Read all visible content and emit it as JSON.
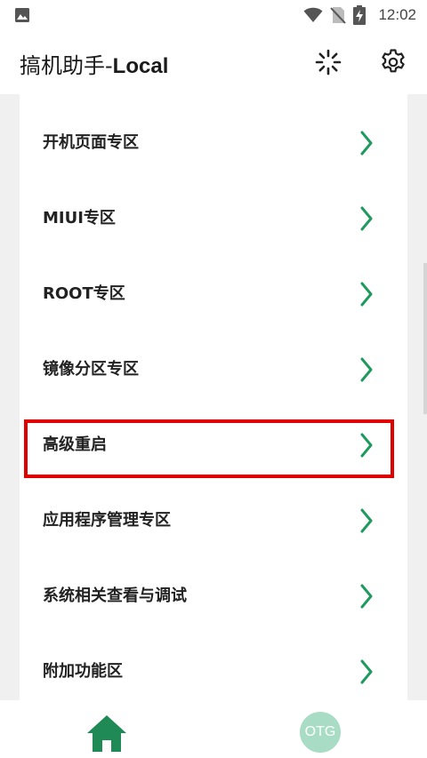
{
  "status_bar": {
    "time": "12:02",
    "icons": [
      "image-notification-icon",
      "wifi-icon",
      "no-sim-icon",
      "battery-charging-icon"
    ]
  },
  "app_bar": {
    "title_prefix": "搞机助手-",
    "title_suffix": "Local",
    "actions": [
      "loading-spinner-icon",
      "settings-gear-icon"
    ]
  },
  "menu": {
    "items": [
      {
        "label": "开机页面专区"
      },
      {
        "label": "MIUI专区"
      },
      {
        "label": "ROOT专区"
      },
      {
        "label": "镜像分区专区"
      },
      {
        "label": "高级重启",
        "highlighted": true
      },
      {
        "label": "应用程序管理专区"
      },
      {
        "label": "系统相关查看与调试"
      },
      {
        "label": "附加功能区"
      }
    ]
  },
  "bottom_nav": {
    "home_icon": "home-icon",
    "otg_label": "OTG"
  },
  "colors": {
    "accent_green": "#1f9a5e",
    "otg_circle": "#a8dcc4",
    "highlight_red": "#e00000"
  }
}
